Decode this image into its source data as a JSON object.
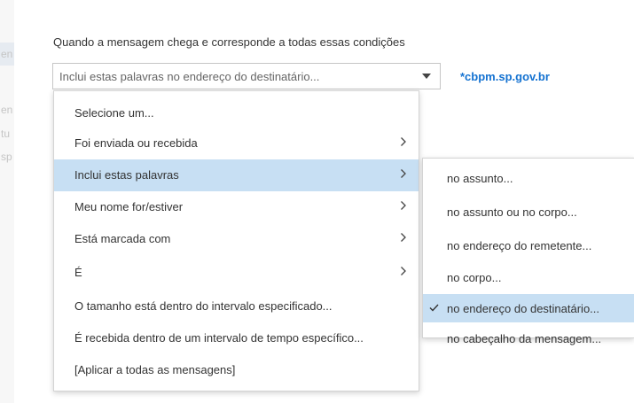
{
  "background_fragments": [
    "en",
    "en",
    "tu",
    "sp"
  ],
  "condition_heading": "Quando a mensagem chega e corresponde a todas essas condições",
  "condition_dropdown": {
    "value": "Inclui estas palavras no endereço do destinatário...",
    "icon": "caret-down-icon"
  },
  "domain_value": "*cbpm.sp.gov.br",
  "menu": {
    "items": [
      {
        "label": "Selecione um...",
        "has_submenu": false
      },
      {
        "label": "Foi enviada ou recebida",
        "has_submenu": true
      },
      {
        "label": "Inclui estas palavras",
        "has_submenu": true,
        "active": true
      },
      {
        "label": "Meu nome for/estiver",
        "has_submenu": true
      },
      {
        "label": "Está marcada com",
        "has_submenu": true
      },
      {
        "label": "É",
        "has_submenu": true
      },
      {
        "label": "O tamanho está dentro do intervalo especificado...",
        "has_submenu": false
      },
      {
        "label": "É recebida dentro de um intervalo de tempo específico...",
        "has_submenu": false
      },
      {
        "label": "[Aplicar a todas as mensagens]",
        "has_submenu": false
      }
    ]
  },
  "submenu": {
    "items": [
      {
        "label": "no assunto..."
      },
      {
        "label": "no assunto ou no corpo..."
      },
      {
        "label": "no endereço do remetente..."
      },
      {
        "label": "no corpo..."
      },
      {
        "label": "no endereço do destinatário...",
        "selected": true
      },
      {
        "label": "no cabeçalho da mensagem..."
      }
    ]
  },
  "colors": {
    "highlight": "#c7dff3",
    "link": "#1472d1",
    "text": "#333333"
  }
}
